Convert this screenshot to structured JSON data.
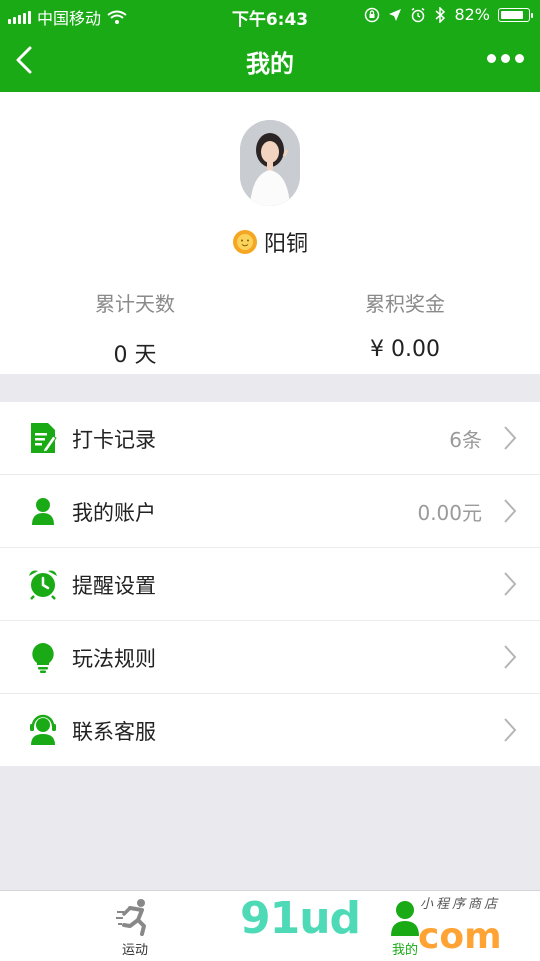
{
  "status_bar": {
    "carrier": "中国移动",
    "time": "下午6:43",
    "battery": "82%"
  },
  "navbar": {
    "title": "我的"
  },
  "profile": {
    "nickname": "阳铜"
  },
  "stats": [
    {
      "label": "累计天数",
      "value": "0 天"
    },
    {
      "label": "累积奖金",
      "value": "¥ 0.00"
    }
  ],
  "menu": [
    {
      "label": "打卡记录",
      "value": "6条",
      "icon": "checkin-record-icon"
    },
    {
      "label": "我的账户",
      "value": "0.00元",
      "icon": "account-icon"
    },
    {
      "label": "提醒设置",
      "value": "",
      "icon": "alarm-clock-icon"
    },
    {
      "label": "玩法规则",
      "value": "",
      "icon": "lightbulb-icon"
    },
    {
      "label": "联系客服",
      "value": "",
      "icon": "customer-service-icon"
    }
  ],
  "tabs": [
    {
      "label": "运动",
      "icon": "running-icon"
    },
    {
      "label": "我的",
      "icon": "user-icon",
      "active": true
    }
  ],
  "watermark": {
    "main": "91ud",
    "domain": "com",
    "tagline": "小程序商店"
  },
  "colors": {
    "brand_green": "#1aaa16",
    "background": "#e9e9ee"
  }
}
